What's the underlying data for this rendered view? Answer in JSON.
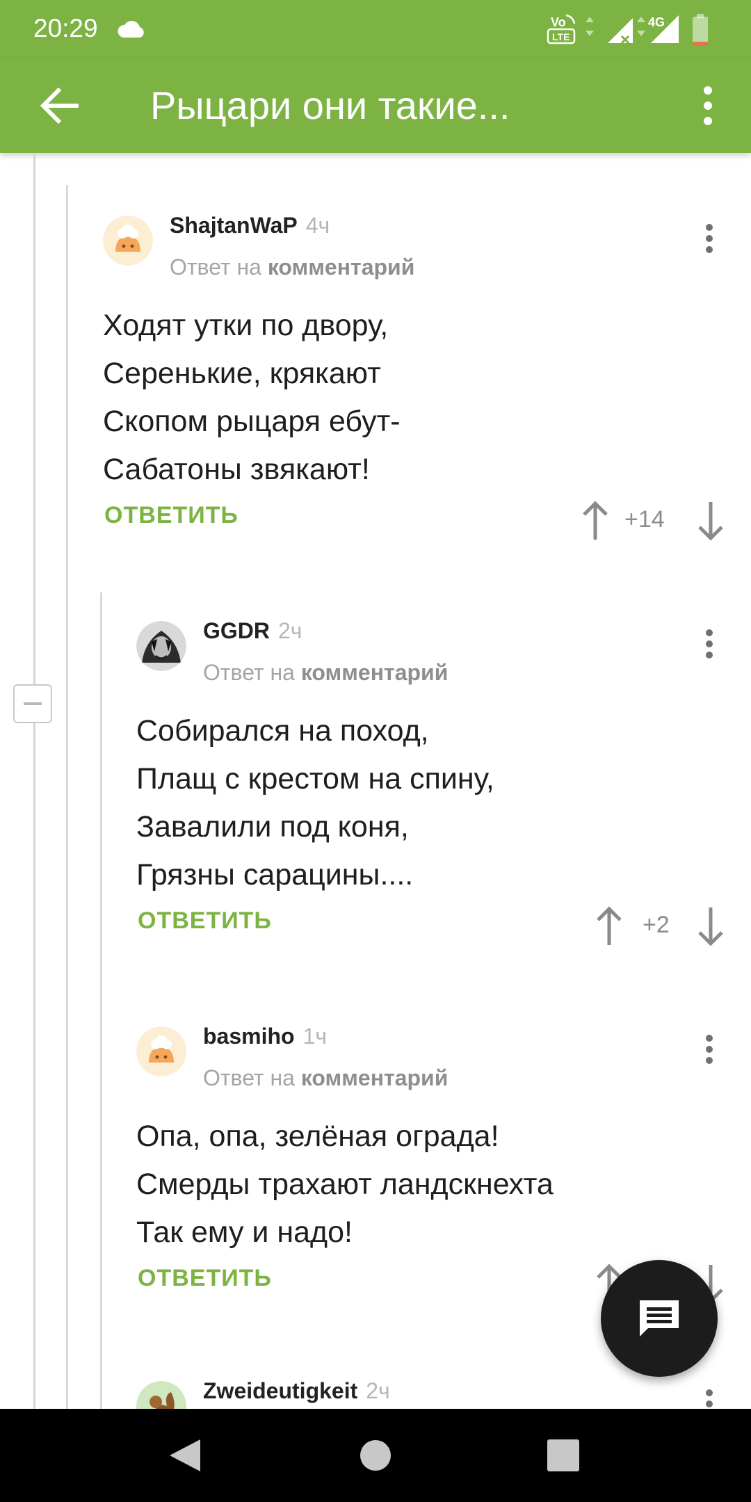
{
  "status_bar": {
    "time": "20:29",
    "network": "4G",
    "volte_label": "VoLTE",
    "icons": [
      "cloud-icon",
      "volte-icon",
      "signal-icon",
      "battery-icon"
    ]
  },
  "app_bar": {
    "title": "Рыцари они такие...",
    "back_icon": "arrow-left-icon",
    "more_icon": "more-vertical-icon"
  },
  "reply_label": "Ответ на",
  "reply_target": "комментарий",
  "reply_button_label": "ОТВЕТИТЬ",
  "comments": [
    {
      "author": "ShajtanWaP",
      "time": "4ч",
      "avatar": "default-avatar",
      "lines": [
        "Ходят утки по двору,",
        "Серенькие, крякают",
        "Скопом рыцаря ебут-",
        "Сабатоны звякают!"
      ],
      "score": "+14"
    },
    {
      "author": "GGDR",
      "time": "2ч",
      "avatar": "photo-avatar",
      "lines": [
        "Собирался на поход,",
        "Плащ с крестом на спину,",
        "Завалили под коня,",
        "Грязны сарацины...."
      ],
      "score": "+2"
    },
    {
      "author": "basmiho",
      "time": "1ч",
      "avatar": "default-avatar",
      "lines": [
        "Опа, опа, зелёная ограда!",
        "Смерды трахают ландскнехта",
        "Так ему и надо!"
      ],
      "score": ""
    },
    {
      "author": "Zweideutigkeit",
      "time": "2ч",
      "avatar": "squirrel-avatar",
      "lines": [],
      "score": ""
    }
  ],
  "fab_icon": "comment-icon",
  "nav": [
    "back-triangle-icon",
    "home-circle-icon",
    "recents-square-icon"
  ],
  "colors": {
    "accent": "#7cb342",
    "text": "#1e1e1e",
    "muted": "#a5a5a5",
    "fab": "#1c1c1c",
    "navbar": "#000000"
  }
}
